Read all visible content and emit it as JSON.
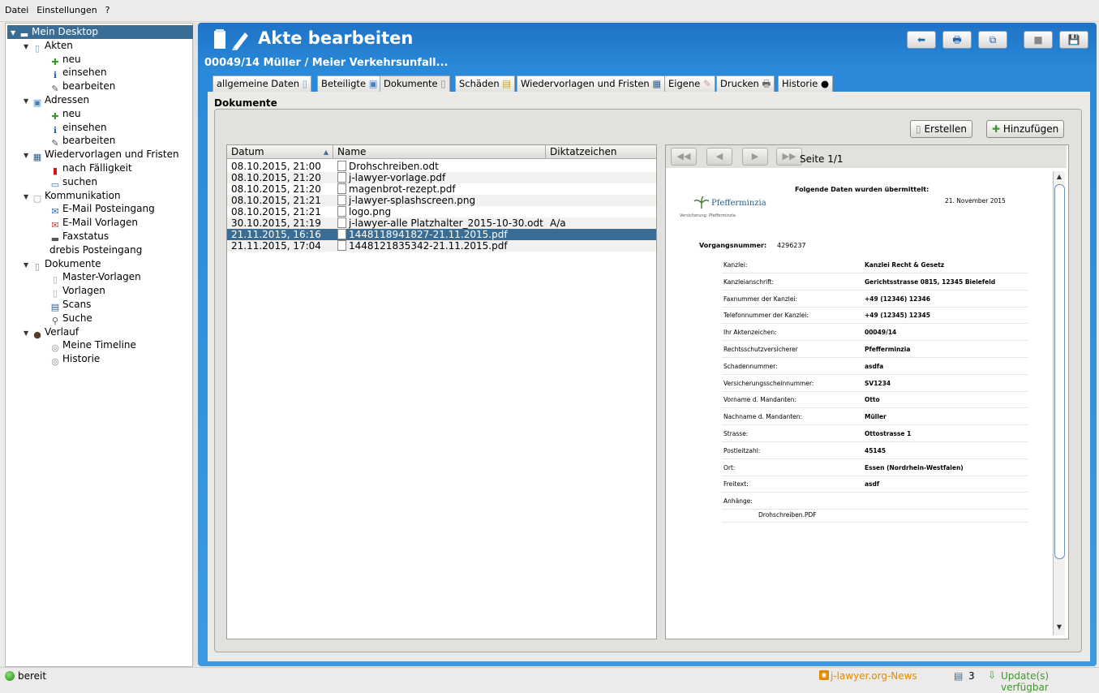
{
  "menu": [
    "Datei",
    "Einstellungen",
    "?"
  ],
  "tree": [
    {
      "label": "Mein Desktop",
      "level": 0,
      "tri": "▼",
      "icon": "desktop-icon",
      "selected": true
    },
    {
      "label": "Akten",
      "level": 1,
      "tri": "▼",
      "icon": "folder-icon"
    },
    {
      "label": "neu",
      "level": 2,
      "icon": "plus-icon"
    },
    {
      "label": "einsehen",
      "level": 2,
      "icon": "info-icon"
    },
    {
      "label": "bearbeiten",
      "level": 2,
      "icon": "edit-icon"
    },
    {
      "label": "Adressen",
      "level": 1,
      "tri": "▼",
      "icon": "address-icon"
    },
    {
      "label": "neu",
      "level": 2,
      "icon": "plus-icon"
    },
    {
      "label": "einsehen",
      "level": 2,
      "icon": "info-icon"
    },
    {
      "label": "bearbeiten",
      "level": 2,
      "icon": "edit-icon"
    },
    {
      "label": "Wiedervorlagen und Fristen",
      "level": 1,
      "tri": "▼",
      "icon": "calendar-icon"
    },
    {
      "label": "nach Fälligkeit",
      "level": 2,
      "icon": "flag-icon"
    },
    {
      "label": "suchen",
      "level": 2,
      "icon": "search-icon"
    },
    {
      "label": "Kommunikation",
      "level": 1,
      "tri": "▼",
      "icon": "communication-icon"
    },
    {
      "label": "E-Mail Posteingang",
      "level": 2,
      "icon": "mail-inbox-icon"
    },
    {
      "label": "E-Mail Vorlagen",
      "level": 2,
      "icon": "mail-template-icon"
    },
    {
      "label": "Faxstatus",
      "level": 2,
      "icon": "fax-icon"
    },
    {
      "label": "drebis  Posteingang",
      "level": 2,
      "icon": "drebis-icon"
    },
    {
      "label": "Dokumente",
      "level": 1,
      "tri": "▼",
      "icon": "documents-icon"
    },
    {
      "label": "Master-Vorlagen",
      "level": 2,
      "icon": "master-template-icon"
    },
    {
      "label": "Vorlagen",
      "level": 2,
      "icon": "template-icon"
    },
    {
      "label": "Scans",
      "level": 2,
      "icon": "scan-icon"
    },
    {
      "label": "Suche",
      "level": 2,
      "icon": "magnifier-icon"
    },
    {
      "label": "Verlauf",
      "level": 1,
      "tri": "▼",
      "icon": "history-icon"
    },
    {
      "label": "Meine Timeline",
      "level": 2,
      "icon": "timeline-icon"
    },
    {
      "label": "Historie",
      "level": 2,
      "icon": "history-item-icon"
    }
  ],
  "header": {
    "title": "Akte bearbeiten",
    "subtitle": "00049/14 Müller / Meier Verkehrsunfall..."
  },
  "toolbar": [
    "back-arrow-icon",
    "print-icon",
    "copy-icon",
    "disabled-icon",
    "save-icon"
  ],
  "tabs": [
    {
      "label": "allgemeine Daten",
      "icon": "folder-icon"
    },
    {
      "label": "Beteiligte",
      "icon": "address-icon"
    },
    {
      "label": "Dokumente",
      "icon": "documents-icon",
      "active": true
    },
    {
      "label": "Schäden",
      "icon": "damage-icon"
    },
    {
      "label": "Wiedervorlagen und Fristen",
      "icon": "calendar-icon"
    },
    {
      "label": "Eigene",
      "icon": "custom-icon"
    },
    {
      "label": "Drucken",
      "icon": "print-icon"
    },
    {
      "label": "Historie",
      "icon": "history-icon"
    }
  ],
  "section_title": "Dokumente",
  "buttons": {
    "create": "Erstellen",
    "add": "Hinzufügen"
  },
  "table": {
    "columns": [
      "Datum",
      "Name",
      "Diktatzeichen"
    ],
    "rows": [
      {
        "date": "08.10.2015, 21:00",
        "name": "Drohschreiben.odt",
        "dict": ""
      },
      {
        "date": "08.10.2015, 21:20",
        "name": "j-lawyer-vorlage.pdf",
        "dict": ""
      },
      {
        "date": "08.10.2015, 21:20",
        "name": "magenbrot-rezept.pdf",
        "dict": ""
      },
      {
        "date": "08.10.2015, 21:21",
        "name": "j-lawyer-splashscreen.png",
        "dict": ""
      },
      {
        "date": "08.10.2015, 21:21",
        "name": "logo.png",
        "dict": ""
      },
      {
        "date": "30.10.2015, 21:19",
        "name": "j-lawyer-alle Platzhalter_2015-10-30.odt",
        "dict": "A/a"
      },
      {
        "date": "21.11.2015, 16:16",
        "name": "1448118941827-21.11.2015.pdf",
        "dict": "",
        "selected": true
      },
      {
        "date": "21.11.2015, 17:04",
        "name": "1448121835342-21.11.2015.pdf",
        "dict": ""
      }
    ]
  },
  "preview": {
    "page_info": "Seite 1/1",
    "doc_heading": "Folgende Daten wurden übermittelt:",
    "doc_date": "21. November 2015",
    "logo_text": "Pfefferminzia",
    "logo_sub": "Versicherung: Pfefferminzia",
    "case_label": "Vorgangsnummer:",
    "case_value": "4296237",
    "fields": [
      {
        "label": "Kanzlei:",
        "value": "Kanzlei Recht & Gesetz"
      },
      {
        "label": "Kanzleianschrift:",
        "value": "Gerichtsstrasse 0815, 12345 Bielefeld"
      },
      {
        "label": "Faxnummer der Kanzlei:",
        "value": "+49 (12346) 12346"
      },
      {
        "label": "Telefonnummer der Kanzlei:",
        "value": "+49 (12345) 12345"
      },
      {
        "label": "Ihr Aktenzeichen:",
        "value": "00049/14"
      },
      {
        "label": "Rechtsschutzversicherer",
        "value": "Pfefferminzia"
      },
      {
        "label": "Schadennummer:",
        "value": "asdfa"
      },
      {
        "label": "Versicherungsscheinnummer:",
        "value": "SV1234"
      },
      {
        "label": "Vorname d. Mandanten:",
        "value": "Otto"
      },
      {
        "label": "Nachname d. Mandanten:",
        "value": "Müller"
      },
      {
        "label": "Strasse:",
        "value": "Ottostrasse 1"
      },
      {
        "label": "Postleitzahl:",
        "value": "45145"
      },
      {
        "label": "Ort:",
        "value": "Essen (Nordrhein-Westfalen)"
      },
      {
        "label": "Freitext:",
        "value": "asdf"
      },
      {
        "label": "Anhänge:",
        "value": ""
      }
    ],
    "attachment": "Drohschreiben.PDF"
  },
  "status": {
    "text": "bereit",
    "news": "j-lawyer.org-News",
    "count": "3",
    "updates": "Update(s) verfügbar"
  },
  "colors": {
    "accent": "#2a8ad9",
    "selection": "#3a6d96",
    "news": "#e08a00",
    "updates": "#3a9a2a"
  }
}
